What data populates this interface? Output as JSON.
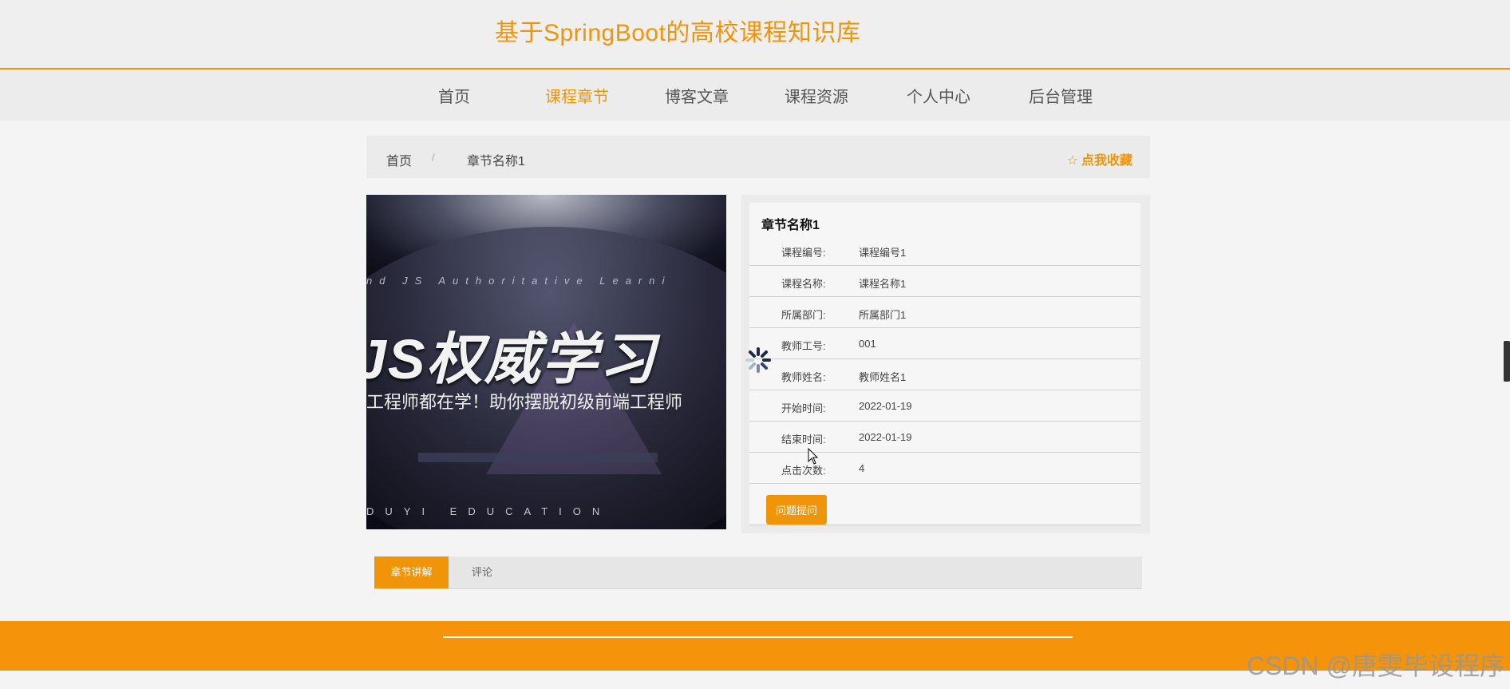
{
  "site": {
    "title": "基于SpringBoot的高校课程知识库"
  },
  "nav": {
    "items": [
      {
        "label": "首页"
      },
      {
        "label": "课程章节"
      },
      {
        "label": "博客文章"
      },
      {
        "label": "课程资源"
      },
      {
        "label": "个人中心"
      },
      {
        "label": "后台管理"
      }
    ],
    "active_index": 1
  },
  "breadcrumb": {
    "home": "首页",
    "separator": "/",
    "current": "章节名称1"
  },
  "favorite": {
    "label": "点我收藏",
    "icon": "star-outline-icon"
  },
  "cover": {
    "en_text": "nd JS Authoritative Learni",
    "big_text": "JS权威学习",
    "sub_text": "工程师都在学！助你摆脱初级前端工程师",
    "footer_text": "DUYI EDUCATION"
  },
  "detail": {
    "title": "章节名称1",
    "fields": [
      {
        "label": "课程编号:",
        "value": "课程编号1"
      },
      {
        "label": "课程名称:",
        "value": "课程名称1"
      },
      {
        "label": "所属部门:",
        "value": "所属部门1"
      },
      {
        "label": "教师工号:",
        "value": "001"
      },
      {
        "label": "教师姓名:",
        "value": "教师姓名1"
      },
      {
        "label": "开始时间:",
        "value": "2022-01-19"
      },
      {
        "label": "结束时间:",
        "value": "2022-01-19"
      },
      {
        "label": "点击次数:",
        "value": "4"
      }
    ],
    "ask_button": "问题提问"
  },
  "tabs": [
    {
      "label": "章节讲解"
    },
    {
      "label": "评论"
    }
  ],
  "watermark": "CSDN @唐雯毕设程序",
  "colors": {
    "accent": "#f0940a",
    "footer": "#f5940a"
  }
}
